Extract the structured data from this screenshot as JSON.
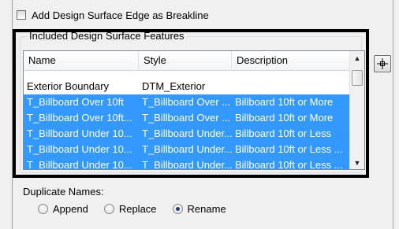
{
  "options": {
    "breakline_checkbox": {
      "label": "Add Design Surface Edge as Breakline",
      "checked": false
    }
  },
  "features_group": {
    "title": "Included Design Surface Features",
    "columns": [
      "Name",
      "Style",
      "Description"
    ],
    "rows": [
      {
        "name": "Exterior Boundary",
        "style": "DTM_Exterior",
        "description": "",
        "selected": false
      },
      {
        "name": "T_Billboard Over 10ft",
        "style": "T_Billboard Over ...",
        "description": "Billboard 10ft or More",
        "selected": true
      },
      {
        "name": "T_Billboard Over 10ft...",
        "style": "T_Billboard Over ...",
        "description": "Billboard 10ft or More",
        "selected": true
      },
      {
        "name": "T_Billboard Under 10...",
        "style": "T_Billboard Under...",
        "description": "Billboard 10ft or Less",
        "selected": true
      },
      {
        "name": "T_Billboard Under 10...",
        "style": "T_Billboard Under...",
        "description": "Billboard 10ft or Less ...",
        "selected": true
      },
      {
        "name": "T_Billboard Under 10...",
        "style": "T_Billboard Under...",
        "description": "Billboard 10ft or Less ...",
        "selected": true
      }
    ]
  },
  "duplicate_names": {
    "label": "Duplicate Names:",
    "options": [
      {
        "label": "Append",
        "checked": false
      },
      {
        "label": "Replace",
        "checked": false
      },
      {
        "label": "Rename",
        "checked": true
      }
    ]
  },
  "colors": {
    "selection": "#3399ff",
    "highlight_frame": "#000000"
  },
  "icons": {
    "picker_button": "crosshair-icon",
    "scroll_up": "scroll-up-arrow-icon",
    "scroll_down": "scroll-down-arrow-icon"
  }
}
